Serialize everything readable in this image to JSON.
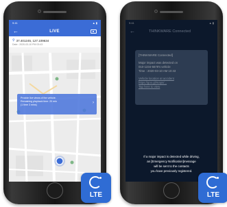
{
  "left_phone": {
    "status_time": "9:41",
    "status_icons": "▲ ▮",
    "header": {
      "title": "LIVE"
    },
    "coordinates": "37.401245, 127.109634",
    "date": "Date : 2020-03-10 PM 03:43",
    "notice_lines": [
      "Provide live views of the vehicle.",
      "Remaining playback time: 20 min",
      "(1 time 3 mins)"
    ]
  },
  "right_phone": {
    "status_time": "9:41",
    "status_icons": "▲ ▮",
    "header": {
      "title": "THINKWARE Connected"
    },
    "message": {
      "title": "[THINKWARE Connected]",
      "body_lines": [
        "Major impact was detected on",
        "010-1234-5678's vehicle",
        "Time : 2020-03-10 AM 10:43"
      ],
      "link_lines": [
        "Vehicle location at accident",
        "https://goo.gl/maps/...",
        "Tap here to view"
      ]
    },
    "footer_lines": [
      "If a major impact is detected while driving,",
      "an [Emergency Notification]message",
      "will be sent to the contacts",
      "you have previously registered."
    ]
  },
  "badges": [
    {
      "label": "LTE"
    },
    {
      "label": "LTE"
    }
  ],
  "colors": {
    "accent": "#3b6cd6",
    "dark_bg": "#0f1d33",
    "card": "#41546f",
    "badge": "#2f6cd4"
  }
}
